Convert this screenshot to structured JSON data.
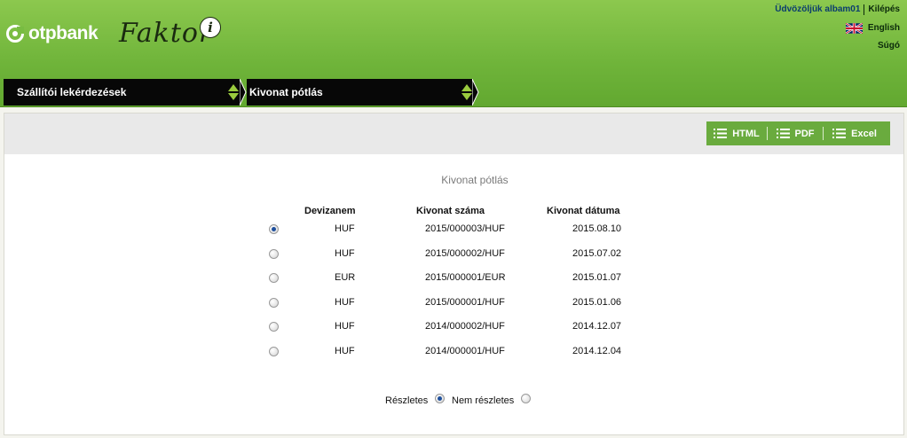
{
  "header": {
    "logo_text": "otpbank",
    "brand_text": "Faktor",
    "brand_badge": "i",
    "welcome": "Üdvözöljük albam01",
    "logout": "Kilépés",
    "language": "English",
    "help": "Súgó"
  },
  "breadcrumb": [
    {
      "label": "Szállítói lekérdezések"
    },
    {
      "label": "Kivonat pótlás"
    }
  ],
  "toolbar": {
    "html_label": "HTML",
    "pdf_label": "PDF",
    "excel_label": "Excel"
  },
  "main": {
    "title": "Kivonat pótlás",
    "columns": [
      "Devizanem",
      "Kivonat száma",
      "Kivonat dátuma"
    ],
    "rows": [
      {
        "currency": "HUF",
        "number": "2015/000003/HUF",
        "date": "2015.08.10",
        "selected": true
      },
      {
        "currency": "HUF",
        "number": "2015/000002/HUF",
        "date": "2015.07.02",
        "selected": false
      },
      {
        "currency": "EUR",
        "number": "2015/000001/EUR",
        "date": "2015.01.07",
        "selected": false
      },
      {
        "currency": "HUF",
        "number": "2015/000001/HUF",
        "date": "2015.01.06",
        "selected": false
      },
      {
        "currency": "HUF",
        "number": "2014/000002/HUF",
        "date": "2014.12.07",
        "selected": false
      },
      {
        "currency": "HUF",
        "number": "2014/000001/HUF",
        "date": "2014.12.04",
        "selected": false
      }
    ],
    "detail_option": {
      "label": "Részletes",
      "selected": true
    },
    "nodetail_option": {
      "label": "Nem részletes",
      "selected": false
    }
  },
  "colors": {
    "header_green": "#6fb43a",
    "export_green": "#6aab3e",
    "breadcrumb_black": "#070707",
    "radio_dot": "#1e4f9c"
  },
  "icons": [
    "otp-logo-icon",
    "uk-flag-icon",
    "updown-arrows-icon",
    "list-icon"
  ]
}
